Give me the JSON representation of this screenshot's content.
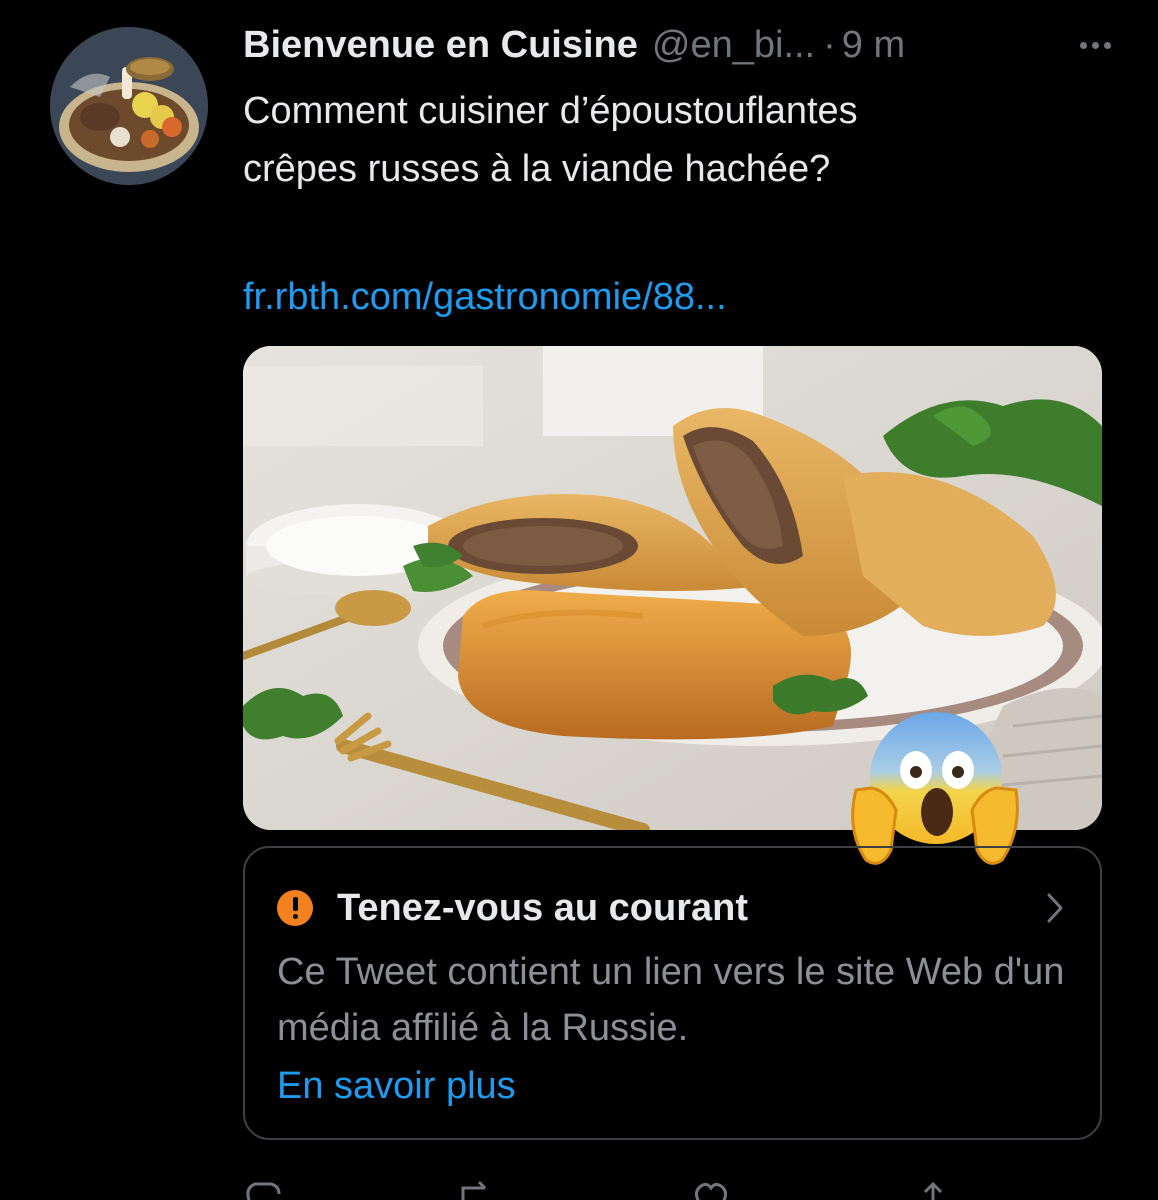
{
  "tweet": {
    "display_name": "Bienvenue en Cuisine",
    "handle": "@en_bi...",
    "separator": "·",
    "time": "9 m",
    "text_line1": "Comment cuisiner d’époustouflantes",
    "text_line2": "crêpes russes à la viande hachée?",
    "link": "fr.rbth.com/gastronomie/88..."
  },
  "notice": {
    "title": "Tenez-vous au courant",
    "text": "Ce Tweet contient un lien vers le site Web d'un média affilié à la Russie.",
    "learn_more": "En savoir plus"
  },
  "icons": {
    "more": "more-horizontal-icon",
    "warning": "warning-circle-icon",
    "chevron": "chevron-right-icon",
    "reply": "reply-icon",
    "retweet": "retweet-icon",
    "like": "heart-icon",
    "share": "share-icon",
    "emoji": "face-screaming-in-fear-emoji"
  },
  "colors": {
    "background": "#000000",
    "text": "#e7e9ea",
    "secondary": "#71767b",
    "link": "#1d9bf0",
    "warning": "#f4811f"
  }
}
